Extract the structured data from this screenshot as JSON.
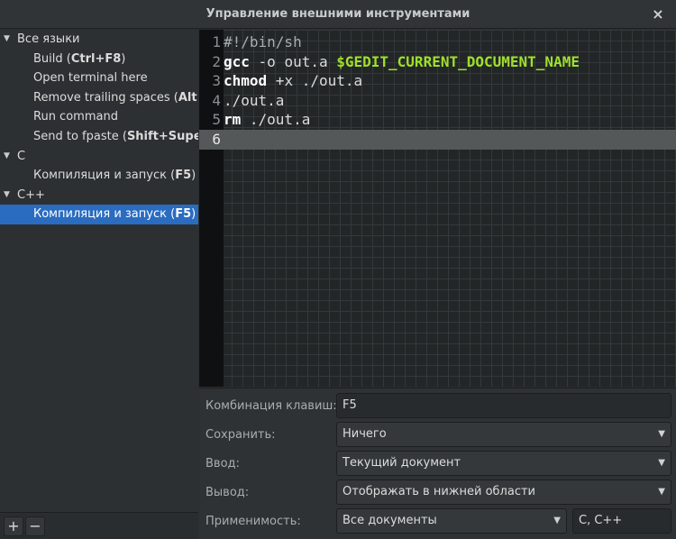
{
  "window": {
    "title": "Управление внешними инструментами",
    "close": "×"
  },
  "sidebar": {
    "groups": [
      {
        "label": "Все языки",
        "arrow": "▼",
        "items": [
          {
            "pre": "Build (",
            "key": "Ctrl+F8",
            "post": ")"
          },
          {
            "pre": "Open terminal here",
            "key": "",
            "post": ""
          },
          {
            "pre": "Remove trailing spaces (",
            "key": "Alt+",
            "post": ""
          },
          {
            "pre": "Run command",
            "key": "",
            "post": ""
          },
          {
            "pre": "Send to fpaste (",
            "key": "Shift+Super",
            "post": ""
          }
        ]
      },
      {
        "label": "C",
        "arrow": "▼",
        "items": [
          {
            "pre": "Компиляция и запуск (",
            "key": "F5",
            "post": ")"
          }
        ]
      },
      {
        "label": "C++",
        "arrow": "▼",
        "items": [
          {
            "pre": "Компиляция и запуск (",
            "key": "F5",
            "post": ")",
            "selected": true
          }
        ]
      }
    ],
    "toolbar": {
      "add": "+",
      "remove": "−"
    }
  },
  "editor": {
    "lines": [
      {
        "num": "1",
        "tokens": [
          {
            "t": "#!/bin/sh",
            "c": "tok-comment"
          }
        ]
      },
      {
        "num": "2",
        "tokens": [
          {
            "t": "gcc",
            "c": "tok-kw"
          },
          {
            "t": " -o out.a ",
            "c": ""
          },
          {
            "t": "$GEDIT_CURRENT_DOCUMENT_NAME",
            "c": "tok-var"
          }
        ]
      },
      {
        "num": "3",
        "tokens": [
          {
            "t": "chmod",
            "c": "tok-kw"
          },
          {
            "t": " +x ./out.a",
            "c": ""
          }
        ]
      },
      {
        "num": "4",
        "tokens": [
          {
            "t": "./out.a",
            "c": ""
          }
        ]
      },
      {
        "num": "5",
        "tokens": [
          {
            "t": "rm",
            "c": "tok-kw"
          },
          {
            "t": " ./out.a",
            "c": ""
          }
        ]
      },
      {
        "num": "6",
        "tokens": [],
        "current": true
      }
    ]
  },
  "form": {
    "shortcut": {
      "label": "Комбинация клавиш:",
      "value": "F5"
    },
    "save": {
      "label": "Сохранить:",
      "value": "Ничего"
    },
    "input": {
      "label": "Ввод:",
      "value": "Текущий документ"
    },
    "output": {
      "label": "Вывод:",
      "value": "Отображать в нижней области"
    },
    "applicability": {
      "label": "Применимость:",
      "value": "Все документы",
      "languages": "C, C++"
    },
    "caret": "▼"
  }
}
